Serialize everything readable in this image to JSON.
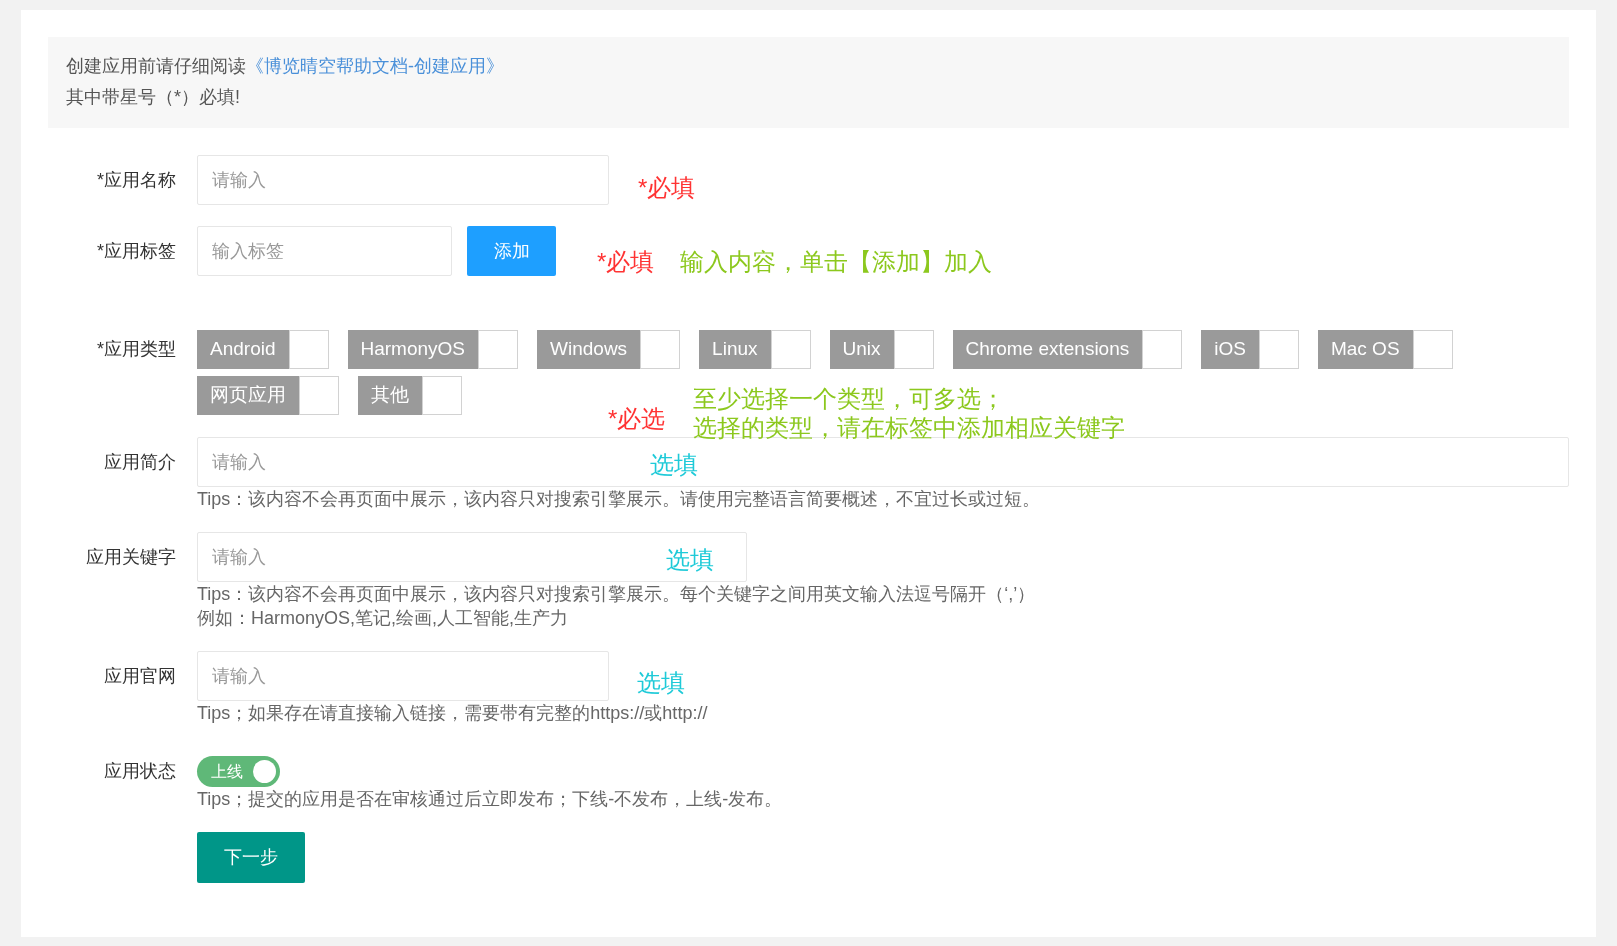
{
  "notice": {
    "text": "创建应用前请仔细阅读",
    "link": "《博览晴空帮助文档-创建应用》",
    "line_2": "其中带星号（*）必填!"
  },
  "name_field": {
    "label": "*应用名称",
    "placeholder": "请输入"
  },
  "tag_field": {
    "label": "*应用标签",
    "placeholder": "输入标签",
    "button": "添加"
  },
  "type_field": {
    "label": "*应用类型",
    "options": [
      {
        "label": "Android",
        "checked": false
      },
      {
        "label": "HarmonyOS",
        "checked": false
      },
      {
        "label": "Windows",
        "checked": false
      },
      {
        "label": "Linux",
        "checked": false
      },
      {
        "label": "Unix",
        "checked": false
      },
      {
        "label": "Chrome extensions",
        "checked": false
      },
      {
        "label": "iOS",
        "checked": false
      },
      {
        "label": "Mac OS",
        "checked": false
      },
      {
        "label": "网页应用",
        "checked": false
      },
      {
        "label": "其他",
        "checked": false
      }
    ]
  },
  "intro_field": {
    "label": "应用简介",
    "placeholder": "请输入",
    "tips": [
      "Tips：该内容不会再页面中展示，该内容只对搜索引擎展示。请使用完整语言简要概述，不宜过长或过短。"
    ]
  },
  "keyword_field": {
    "label": "应用关键字",
    "placeholder": "请输入",
    "tips": [
      "Tips：该内容不会再页面中展示，该内容只对搜索引擎展示。每个关键字之间用英文输入法逗号隔开（‘,’）",
      "例如：HarmonyOS,笔记,绘画,人工智能,生产力"
    ]
  },
  "website_field": {
    "label": "应用官网",
    "placeholder": "请输入",
    "tips": [
      "Tips；如果存在请直接输入链接，需要带有完整的https://或http://"
    ]
  },
  "status_field": {
    "label": "应用状态",
    "toggle_text": "上线",
    "on": true,
    "tips": [
      "Tips；提交的应用是否在审核通过后立即发布；下线-不发布，上线-发布。"
    ]
  },
  "next_button": "下一步",
  "annotations": [
    {
      "text": "*必填",
      "color": "#ff3333"
    },
    {
      "text": "*必填",
      "color": "#ff3333"
    },
    {
      "text": "输入内容，单击【添加】加入",
      "color": "#8cc81e"
    },
    {
      "text": "*必选",
      "color": "#ff3333"
    },
    {
      "text": "至少选择一个类型，可多选；",
      "color": "#8cc81e"
    },
    {
      "text": "选择的类型，请在标签中添加相应关键字",
      "color": "#8cc81e"
    },
    {
      "text": "选填",
      "color": "#1ecad8"
    },
    {
      "text": "选填",
      "color": "#1ecad8"
    },
    {
      "text": "选填",
      "color": "#1ecad8"
    }
  ]
}
